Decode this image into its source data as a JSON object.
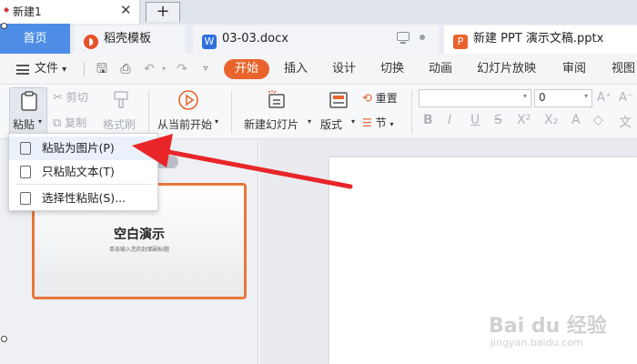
{
  "window_tab": {
    "title": "新建1",
    "close": "✕",
    "new_tab": "+"
  },
  "doc_tabs": [
    {
      "label": "首页"
    },
    {
      "label": "稻壳模板",
      "icon": "daoke-icon"
    },
    {
      "label": "03-03.docx",
      "icon": "word-doc-icon"
    },
    {
      "label": "新建 PPT 演示文稿.pptx",
      "icon": "ppt-doc-icon"
    }
  ],
  "menu": {
    "file": "文件",
    "file_caret": "▾",
    "items": [
      "开始",
      "插入",
      "设计",
      "切换",
      "动画",
      "幻灯片放映",
      "审阅",
      "视图"
    ]
  },
  "ribbon": {
    "paste": "粘贴",
    "cut": "剪切",
    "copy": "复制",
    "format_painter": "格式刷",
    "play_from_current": "从当前开始",
    "new_slide": "新建幻灯片",
    "layout": "版式",
    "reset": "重置",
    "section": "节",
    "font_size_value": "0",
    "format_buttons": [
      "B",
      "I",
      "U",
      "S",
      "X²",
      "X₂",
      "A",
      "◇",
      "文"
    ]
  },
  "paste_menu": {
    "items": [
      "粘贴为图片(P)",
      "只粘贴文本(T)",
      "选择性粘贴(S)..."
    ],
    "highlighted_index": 0
  },
  "slide_panel": {
    "title": "空白演示",
    "subtitle": "单击输入您的封面副标题"
  },
  "watermark": {
    "main": "Bai du 经验",
    "url": "jingyan.baidu.com"
  },
  "colors": {
    "accent_orange": "#e8642c",
    "home_tab_blue": "#4d8de6",
    "arrow_red": "#e8262a"
  }
}
